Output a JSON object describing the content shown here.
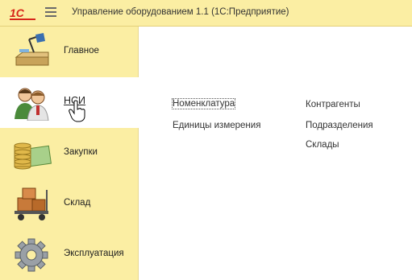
{
  "titlebar": {
    "logo_text": "1С",
    "app_title": "Управление оборудованием 1.1  (1С:Предприятие)"
  },
  "sections": [
    {
      "label": "Главное",
      "icon": "desk-lamp-icon"
    },
    {
      "label": "НСИ",
      "icon": "people-icon",
      "active": true
    },
    {
      "label": "Закупки",
      "icon": "coins-money-icon"
    },
    {
      "label": "Склад",
      "icon": "boxes-cart-icon"
    },
    {
      "label": "Эксплуатация",
      "icon": "gear-icon"
    }
  ],
  "content": {
    "column1": [
      "Номенклатура",
      "Единицы измерения"
    ],
    "column2": [
      "Контрагенты",
      "Подразделения",
      "Склады"
    ]
  },
  "colors": {
    "panel_bg": "#fbeea3",
    "logo_red": "#d7261b",
    "content_bg": "#ffffff"
  }
}
